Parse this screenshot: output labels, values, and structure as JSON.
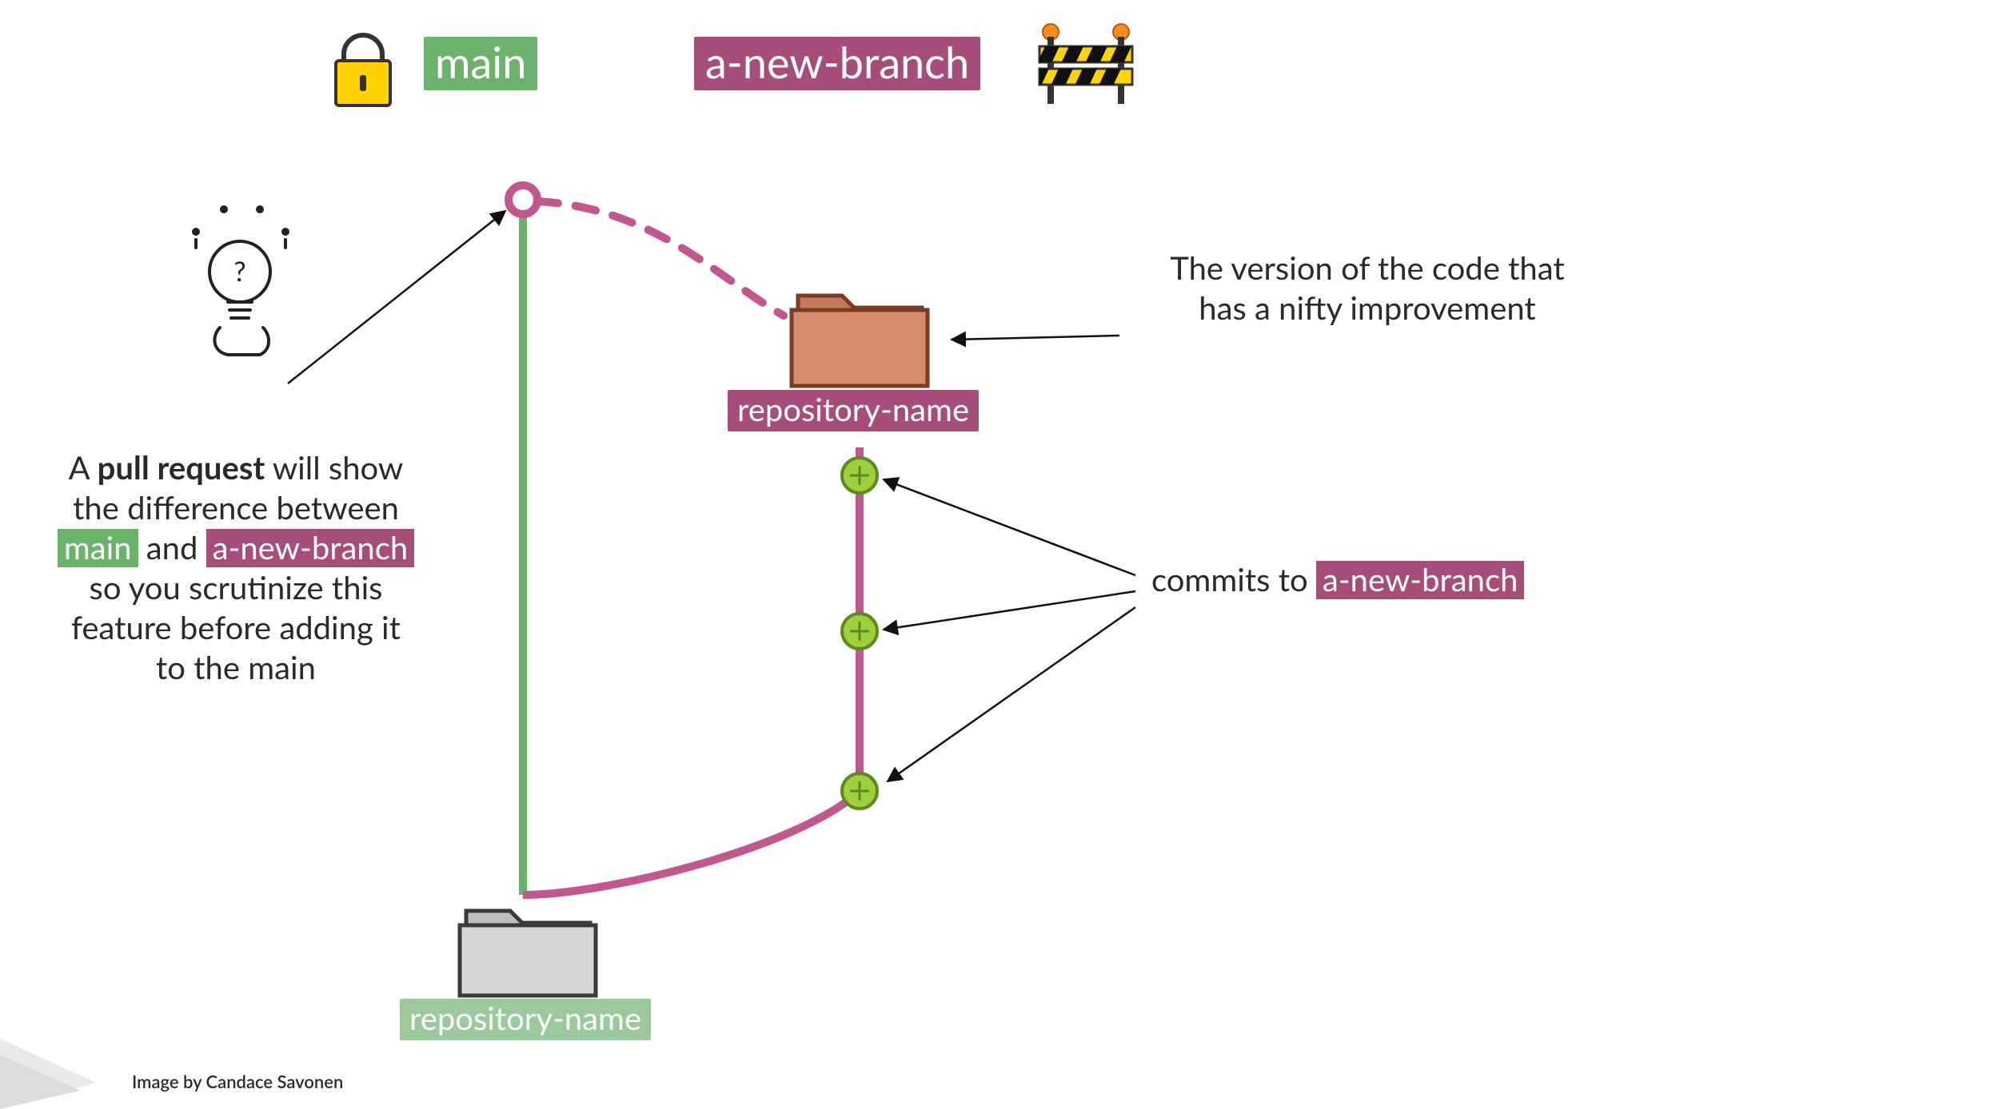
{
  "header": {
    "main_label": "main",
    "branch_label": "a-new-branch"
  },
  "branch_repo_label": "repository-name",
  "main_repo_label": "repository-name",
  "version_caption": "The version of the code that has a nifty improvement",
  "commits_caption_prefix": "commits to ",
  "commits_caption_branch": "a-new-branch",
  "pr_caption": {
    "line1_a": "A ",
    "line1_b": "pull request",
    "line1_c": " will show",
    "line2": "the difference between",
    "line3_main": "main",
    "line3_mid": " and ",
    "line3_branch": "a-new-branch",
    "line4": "so you scrutinize this",
    "line5": "feature before adding it",
    "line6": "to the main"
  },
  "attribution": "Image by Candace Savonen",
  "colors": {
    "green": "#6bb36b",
    "green_light": "#9bc99b",
    "pink": "#a64d79",
    "magenta_line": "#c2568f",
    "commit_fill": "#9fcf3a",
    "commit_stroke": "#5b8a21"
  }
}
